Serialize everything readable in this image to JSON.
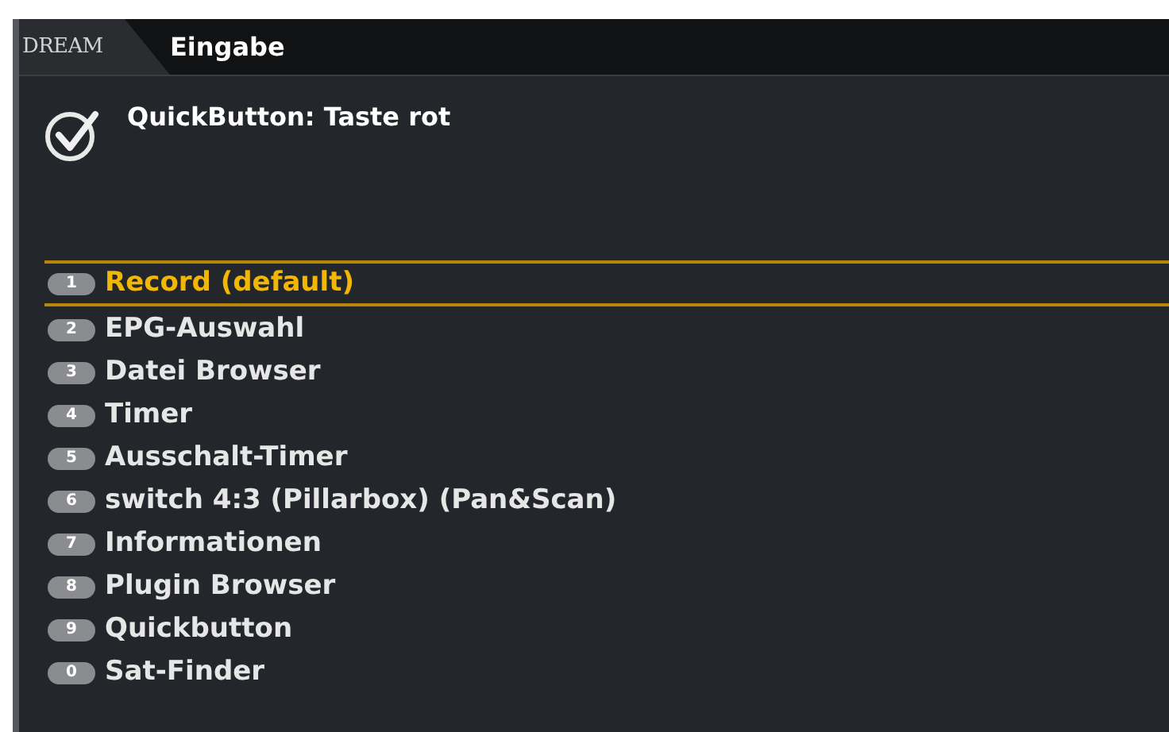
{
  "header": {
    "logo": "DREAM",
    "title": "Eingabe"
  },
  "message": {
    "text": "QuickButton: Taste rot"
  },
  "items": [
    {
      "key": "1",
      "label": "Record (default)",
      "selected": true
    },
    {
      "key": "2",
      "label": "EPG-Auswahl",
      "selected": false
    },
    {
      "key": "3",
      "label": "Datei Browser",
      "selected": false
    },
    {
      "key": "4",
      "label": "Timer",
      "selected": false
    },
    {
      "key": "5",
      "label": "Ausschalt-Timer",
      "selected": false
    },
    {
      "key": "6",
      "label": "switch 4:3 (Pillarbox) (Pan&Scan)",
      "selected": false
    },
    {
      "key": "7",
      "label": "Informationen",
      "selected": false
    },
    {
      "key": "8",
      "label": "Plugin Browser",
      "selected": false
    },
    {
      "key": "9",
      "label": "Quickbutton",
      "selected": false
    },
    {
      "key": "0",
      "label": "Sat-Finder",
      "selected": false
    }
  ]
}
